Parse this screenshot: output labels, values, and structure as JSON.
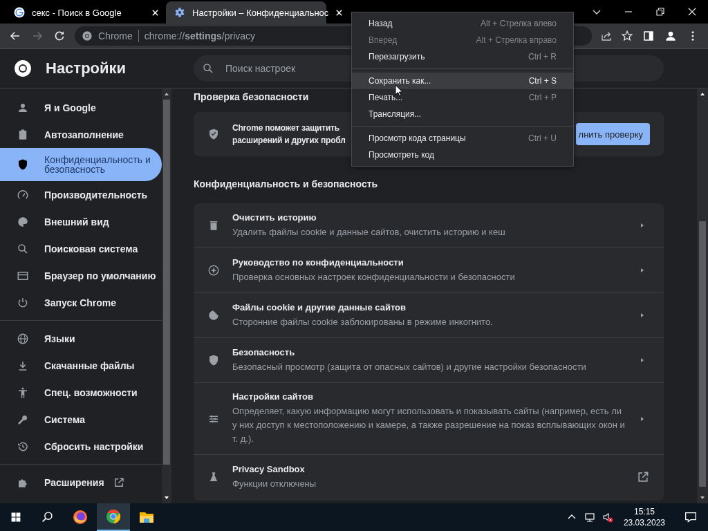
{
  "tabs": [
    {
      "title": "секс - Поиск в Google",
      "kind": "google",
      "selected": false
    },
    {
      "title": "Настройки – Конфиденциальнос",
      "kind": "gear",
      "selected": true
    }
  ],
  "toolbar": {
    "forward_disabled": true,
    "site_label": "Chrome",
    "url": "chrome://**settings**/privacy"
  },
  "header": {
    "title": "Настройки",
    "search": {
      "placeholder": "Поиск настроек"
    }
  },
  "sidebar": {
    "groups": [
      [
        {
          "label": "Я и Google",
          "kind": "person",
          "selected": false
        },
        {
          "label": "Автозаполнение",
          "kind": "clipboard",
          "selected": false
        },
        {
          "label": "Конфиденциальность и безопасность",
          "kind": "shield",
          "selected": true
        },
        {
          "label": "Производительность",
          "kind": "gauge",
          "selected": false
        },
        {
          "label": "Внешний вид",
          "kind": "palette",
          "selected": false
        },
        {
          "label": "Поисковая система",
          "kind": "search",
          "selected": false
        },
        {
          "label": "Браузер по умолчанию",
          "kind": "window",
          "selected": false
        },
        {
          "label": "Запуск Chrome",
          "kind": "power",
          "selected": false
        }
      ],
      [
        {
          "label": "Языки",
          "kind": "globe",
          "selected": false
        },
        {
          "label": "Скачанные файлы",
          "kind": "download",
          "selected": false
        },
        {
          "label": "Спец. возможности",
          "kind": "accessibility",
          "selected": false
        },
        {
          "label": "Система",
          "kind": "wrench",
          "selected": false
        },
        {
          "label": "Сбросить настройки",
          "kind": "history",
          "selected": false
        }
      ],
      [
        {
          "label": "Расширения",
          "kind": "puzzle",
          "selected": false,
          "external": true
        }
      ]
    ]
  },
  "safety_check": {
    "heading": "Проверка безопасности",
    "lines": [
      "Chrome поможет защитить",
      "расширений и других пробл"
    ],
    "button": "лнить проверку"
  },
  "privacy": {
    "heading": "Конфиденциальность и безопасность",
    "rows": [
      {
        "kind": "trash",
        "title": "Очистить историю",
        "subtitle": "Удалить файлы cookie и данные сайтов, очистить историю и кеш",
        "external": false
      },
      {
        "kind": "compass",
        "title": "Руководство по конфиденциальности",
        "subtitle": "Проверка основных настроек конфиденциальности и безопасности",
        "external": false
      },
      {
        "kind": "cookie",
        "title": "Файлы cookie и другие данные сайтов",
        "subtitle": "Сторонние файлы cookie заблокированы в режиме инкогнито.",
        "external": false
      },
      {
        "kind": "shield",
        "title": "Безопасность",
        "subtitle": "Безопасный просмотр (защита от опасных сайтов) и другие настройки безопасности",
        "external": false
      },
      {
        "kind": "sliders",
        "title": "Настройки сайтов",
        "subtitle": "Определяет, какую информацию могут использовать и показывать сайты (например, есть ли у них доступ к местоположению и камере, а также разрешение на показ всплывающих окон и т. д.).",
        "external": false
      },
      {
        "kind": "flask",
        "title": "Privacy Sandbox",
        "subtitle": "Функции отключены",
        "external": true
      }
    ]
  },
  "context_menu": {
    "groups": [
      [
        {
          "label": "Назад",
          "shortcut": "Alt + Стрелка влево",
          "disabled": false,
          "selected": false
        },
        {
          "label": "Вперед",
          "shortcut": "Alt + Стрелка вправо",
          "disabled": true,
          "selected": false
        },
        {
          "label": "Перезагрузить",
          "shortcut": "Ctrl + R",
          "disabled": false,
          "selected": false
        }
      ],
      [
        {
          "label": "Сохранить как...",
          "shortcut": "Ctrl + S",
          "disabled": false,
          "selected": true
        },
        {
          "label": "Печать...",
          "shortcut": "Ctrl + P",
          "disabled": false,
          "selected": false
        },
        {
          "label": "Трансляция...",
          "disabled": false,
          "selected": false
        }
      ],
      [
        {
          "label": "Просмотр кода страницы",
          "shortcut": "Ctrl + U",
          "disabled": false,
          "selected": false
        },
        {
          "label": "Просмотреть код",
          "disabled": false,
          "selected": false
        }
      ]
    ]
  },
  "taskbar": {
    "apps": [
      {
        "kind": "firefox",
        "selected": false
      },
      {
        "kind": "chrome",
        "selected": true
      },
      {
        "kind": "folder",
        "selected": false
      }
    ],
    "time": "15:15",
    "date": "23.03.2023"
  }
}
